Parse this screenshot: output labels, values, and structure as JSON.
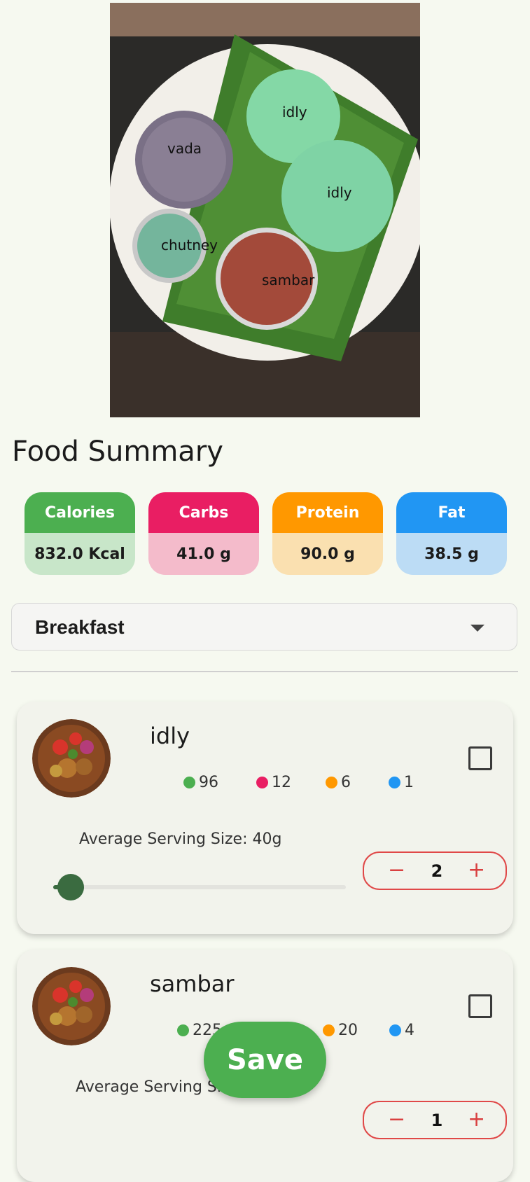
{
  "photo": {
    "labels": [
      "idly",
      "vada",
      "idly",
      "chutney",
      "sambar"
    ]
  },
  "summary": {
    "title": "Food Summary",
    "macros": [
      {
        "label": "Calories",
        "value": "832.0 Kcal",
        "head_color": "#4caf50",
        "body_color": "#c8e6c9"
      },
      {
        "label": "Carbs",
        "value": "41.0 g",
        "head_color": "#e91e63",
        "body_color": "#f4bbcb"
      },
      {
        "label": "Protein",
        "value": "90.0 g",
        "head_color": "#ff9800",
        "body_color": "#fae0b0"
      },
      {
        "label": "Fat",
        "value": "38.5 g",
        "head_color": "#2196f3",
        "body_color": "#bcdcf5"
      }
    ]
  },
  "meal": {
    "selected": "Breakfast"
  },
  "items": [
    {
      "name": "idly",
      "calories": "96",
      "carbs": "12",
      "protein": "6",
      "fat": "1",
      "serving_text": "Average Serving Size: 40g",
      "quantity": "2",
      "slider_fraction": 0.06,
      "checked": false
    },
    {
      "name": "sambar",
      "calories": "225",
      "carbs": "",
      "protein": "20",
      "fat": "4",
      "serving_text": "Average Serving Size",
      "quantity": "1",
      "checked": false
    }
  ],
  "actions": {
    "save_label": "Save",
    "minus_symbol": "−",
    "plus_symbol": "+"
  },
  "colors": {
    "calories": "#4caf50",
    "carbs": "#e91e63",
    "protein": "#ff9800",
    "fat": "#2196f3",
    "stepper": "#e04848",
    "slider": "#3a6b40"
  }
}
